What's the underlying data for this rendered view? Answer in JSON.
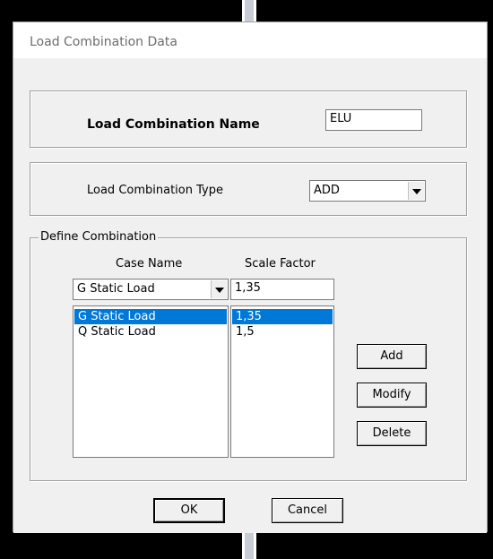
{
  "window": {
    "title": "Load Combination Data"
  },
  "combo_name": {
    "label": "Load Combination Name",
    "value": "ELU"
  },
  "combo_type": {
    "label": "Load Combination Type",
    "value": "ADD"
  },
  "define": {
    "legend": "Define Combination",
    "case_header": "Case Name",
    "scale_header": "Scale Factor",
    "case_select": "G Static Load",
    "scale_input": "1,35",
    "rows": [
      {
        "case": "G Static Load",
        "scale": "1,35",
        "selected": true
      },
      {
        "case": "Q Static Load",
        "scale": "1,5",
        "selected": false
      }
    ],
    "add_label": "Add",
    "modify_label": "Modify",
    "delete_label": "Delete"
  },
  "buttons": {
    "ok_label": "OK",
    "cancel_label": "Cancel"
  },
  "colors": {
    "selection": "#0078d7",
    "dialog_bg": "#f0f0f0"
  }
}
